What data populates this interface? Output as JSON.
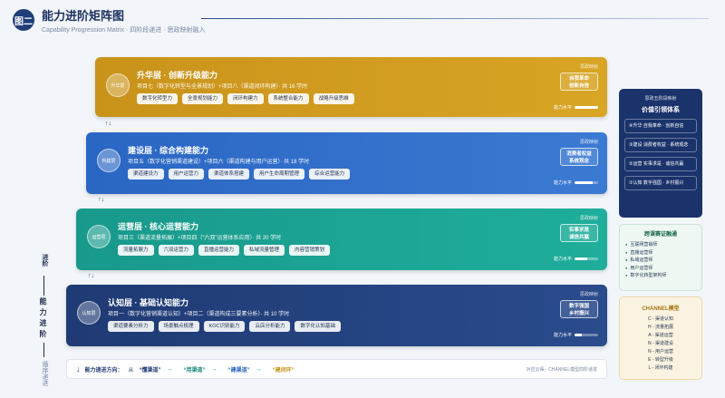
{
  "header": {
    "badge": "图二",
    "title": "能力进阶矩阵图",
    "subtitle": "Capability Progression Matrix · 四阶段递进 · 思政映射融入"
  },
  "axis": {
    "top": "进阶",
    "main": "能力进阶",
    "bottom": "循序递进"
  },
  "layers": [
    {
      "icon_text": "升华层",
      "title": "升华层 · 创新升级能力",
      "desc": "项目七（数字化转型与全景规划）+项目八（渠道闭环构建）· 共 16 学时",
      "tags": [
        "数字化转型力",
        "全景规划能力",
        "闭环构建力",
        "系统整合能力",
        "战略升级思维"
      ],
      "map_label": "思政映射",
      "map_value": "自我革命\n创新自信",
      "level_label": "能力水平",
      "level": 1.0,
      "color": "#c9931a"
    },
    {
      "icon_text": "构建层",
      "title": "建设层 · 综合构建能力",
      "desc": "项目五（数字化营销渠道建设）+项目六（渠道构建与用户运营）· 共 18 学时",
      "tags": [
        "渠道建设力",
        "用户运营力",
        "渠道体系搭建",
        "用户生命周期管理",
        "综合运营能力"
      ],
      "map_label": "思政映射",
      "map_value": "消费者权益\n系统观念",
      "level_label": "能力水平",
      "level": 0.75,
      "color": "#2a66c3"
    },
    {
      "icon_text": "运营层",
      "title": "运营层 · 核心运营能力",
      "desc": "项目三（渠道流量拓展）+项目四（“六双”运营体系应用）· 共 20 学时",
      "tags": [
        "流量拓展力",
        "六双运营力",
        "直播运营能力",
        "私域流量管理",
        "内容营销策划"
      ],
      "map_label": "思政映射",
      "map_value": "实事求是\n诚信共赢",
      "level_label": "能力水平",
      "level": 0.55,
      "color": "#18998c"
    },
    {
      "icon_text": "认知层",
      "title": "认知层 · 基础认知能力",
      "desc": "项目一（数字化营销渠道认知）+项目二（渠道构成三要素分析）· 共 10 学时",
      "tags": [
        "渠道要素分析力",
        "场景触点梳理",
        "KOC识别能力",
        "云店分析能力",
        "数字化认知基础"
      ],
      "map_label": "思政映射",
      "map_value": "数字强国\n乡村振兴",
      "level_label": "能力水平",
      "level": 0.3,
      "color": "#1f3a74"
    }
  ],
  "right_panel": {
    "label": "思政五阶段映射",
    "title": "价值引领体系",
    "items": [
      "④升华 自我革命 · 创新自信",
      "③建设 消费者权益 · 系统观念",
      "②运营 实事求是 · 诚信共赢",
      "①认知 数字强国 · 乡村振兴"
    ]
  },
  "channels_panel": {
    "title": "跨课赛证融通",
    "items": [
      "互联网营销师",
      "直播运营师",
      "私域运营师",
      "用户运营师",
      "数字化转型架构师"
    ]
  },
  "model_panel": {
    "title": "CHANNEL模型",
    "items": [
      "C - 渠道认知",
      "H - 流量拓展",
      "A - 渠道运营",
      "N - 渠道建设",
      "N - 用户运营",
      "E - 转型升级",
      "L - 闭环构建"
    ]
  },
  "footer": {
    "label": "能力递进方向：",
    "from": "从",
    "steps": [
      "“懂渠道”",
      "“用渠道”",
      "“建渠道”",
      "“建闭环”"
    ],
    "right": "对应云渠 · CHANNEL模型四阶递进"
  }
}
